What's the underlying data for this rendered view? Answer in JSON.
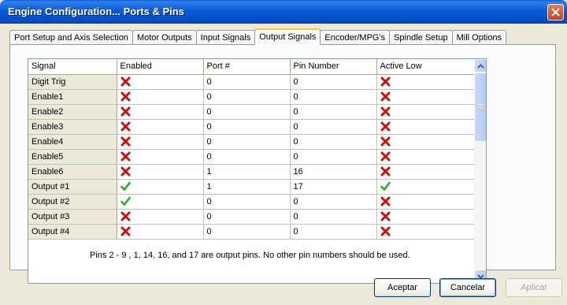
{
  "window": {
    "title": "Engine Configuration... Ports & Pins"
  },
  "tabs": [
    {
      "label": "Port Setup and Axis Selection",
      "active": false
    },
    {
      "label": "Motor Outputs",
      "active": false
    },
    {
      "label": "Input Signals",
      "active": false
    },
    {
      "label": "Output Signals",
      "active": true
    },
    {
      "label": "Encoder/MPG's",
      "active": false
    },
    {
      "label": "Spindle Setup",
      "active": false
    },
    {
      "label": "Mill Options",
      "active": false
    }
  ],
  "table": {
    "columns": [
      "Signal",
      "Enabled",
      "Port #",
      "Pin Number",
      "Active Low"
    ],
    "rows": [
      {
        "signal": "Digit  Trig",
        "enabled": "x-icon",
        "port": "0",
        "pin": "0",
        "active_low": "x-icon"
      },
      {
        "signal": "Enable1",
        "enabled": "x-icon",
        "port": "0",
        "pin": "0",
        "active_low": "x-icon"
      },
      {
        "signal": "Enable2",
        "enabled": "x-icon",
        "port": "0",
        "pin": "0",
        "active_low": "x-icon"
      },
      {
        "signal": "Enable3",
        "enabled": "x-icon",
        "port": "0",
        "pin": "0",
        "active_low": "x-icon"
      },
      {
        "signal": "Enable4",
        "enabled": "x-icon",
        "port": "0",
        "pin": "0",
        "active_low": "x-icon"
      },
      {
        "signal": "Enable5",
        "enabled": "x-icon",
        "port": "0",
        "pin": "0",
        "active_low": "x-icon"
      },
      {
        "signal": "Enable6",
        "enabled": "x-icon",
        "port": "1",
        "pin": "16",
        "active_low": "x-icon"
      },
      {
        "signal": "Output #1",
        "enabled": "check-icon",
        "port": "1",
        "pin": "17",
        "active_low": "check-icon"
      },
      {
        "signal": "Output #2",
        "enabled": "check-icon",
        "port": "0",
        "pin": "0",
        "active_low": "x-icon"
      },
      {
        "signal": "Output #3",
        "enabled": "x-icon",
        "port": "0",
        "pin": "0",
        "active_low": "x-icon"
      },
      {
        "signal": "Output #4",
        "enabled": "x-icon",
        "port": "0",
        "pin": "0",
        "active_low": "x-icon"
      }
    ]
  },
  "note": "Pins 2 - 9 , 1, 14, 16, and 17 are output pins.  No  other pin numbers should be used.",
  "buttons": {
    "ok": "Aceptar",
    "cancel": "Cancelar",
    "apply": "Aplicar"
  },
  "colors": {
    "titlebar": "#0a5fd6",
    "x_icon": "#cc1010",
    "check_icon": "#22aa22",
    "active_tab_accent": "#ffc83c"
  }
}
